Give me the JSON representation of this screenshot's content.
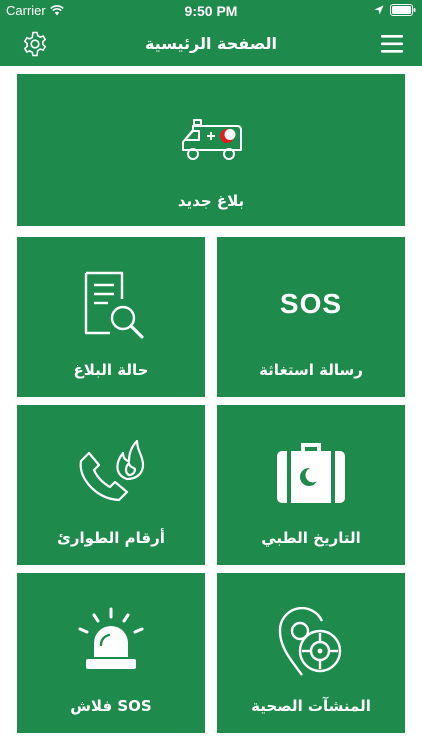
{
  "status_bar": {
    "carrier": "Carrier",
    "time": "9:50 PM"
  },
  "nav": {
    "title": "الصفحة الرئيسية",
    "left_icon": "gear-icon",
    "right_icon": "hamburger-menu-icon"
  },
  "tiles": {
    "new_report": {
      "label": "بلاغ جديد",
      "icon": "ambulance-icon"
    },
    "report_status": {
      "label": "حالة البلاغ",
      "icon": "document-search-icon"
    },
    "sos_message": {
      "label": "رسالة استغاثة",
      "icon_text": "SOS"
    },
    "emergency_numbers": {
      "label": "أرقام الطوارئ",
      "icon": "phone-fire-icon"
    },
    "medical_history": {
      "label": "التاريخ الطبي",
      "icon": "medical-bag-icon"
    },
    "flash_sos": {
      "label": "فلاش SOS",
      "icon": "siren-icon"
    },
    "health_facilities": {
      "label": "المنشآت الصحية",
      "icon": "location-target-icon"
    }
  },
  "colors": {
    "primary_green": "#1e8a4c",
    "crescent_red": "#e31b23"
  }
}
